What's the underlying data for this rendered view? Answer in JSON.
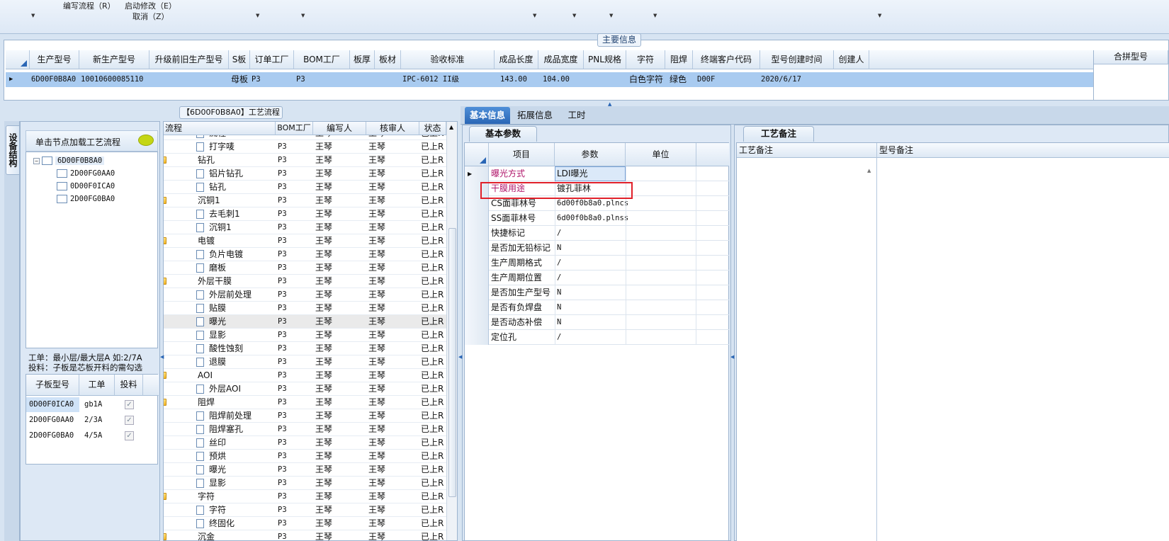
{
  "toolbar": {
    "edit_flow": "编写流程（R）",
    "start_modify": "启动修改（E）",
    "cancel": "取消（Z）"
  },
  "main_info": {
    "title": "主要信息"
  },
  "main_table": {
    "headers": [
      "生产型号",
      "新生产型号",
      "升级前旧生产型号",
      "S板",
      "订单工厂",
      "BOM工厂",
      "板厚",
      "板材",
      "验收标准",
      "成品长度",
      "成品宽度",
      "PNL规格",
      "字符",
      "阻焊",
      "终端客户代码",
      "型号创建时间",
      "创建人"
    ],
    "row": {
      "prod_model": "6D00F0B8A0",
      "new_model": "10010600085110",
      "s_board": "母板",
      "order_factory": "P3",
      "bom_factory": "P3",
      "standard": "IPC-6012 II级",
      "length": "143.00",
      "width": "104.00",
      "char": "白色字符",
      "mask": "绿色",
      "customer": "D00F",
      "created": "2020/6/17"
    },
    "combined_header": "合拼型号"
  },
  "left": {
    "vtab": "设备结构",
    "hint": "单击节点加载工艺流程",
    "tree": [
      "6D00F0B8A0",
      "2D00FG0AA0",
      "0D00F0ICA0",
      "2D00FG0BA0"
    ],
    "note1": "工单：最小层/最大层A 如:2/7A",
    "note2": "投料：子板是芯板开料的需勾选",
    "sub_headers": [
      "子板型号",
      "工单",
      "投料"
    ],
    "sub_rows": [
      [
        "0D00F0ICA0",
        "gb1A",
        "✓"
      ],
      [
        "2D00FG0AA0",
        "2/3A",
        "✓"
      ],
      [
        "2D00FG0BA0",
        "4/5A",
        "✓"
      ]
    ]
  },
  "flow": {
    "title": "【6D00F0B8A0】工艺流程",
    "headers": [
      "流程",
      "BOM工厂",
      "编写人",
      "核审人",
      "状态"
    ],
    "rows": [
      {
        "name": "流程",
        "level": 2,
        "bom": "P3",
        "writer": "王琴",
        "reviewer": "王琴",
        "status": "已上R"
      },
      {
        "name": "打字唛",
        "level": 2,
        "bom": "P3",
        "writer": "王琴",
        "reviewer": "王琴",
        "status": "已上R"
      },
      {
        "name": "钻孔",
        "level": 1,
        "bom": "P3",
        "writer": "王琴",
        "reviewer": "王琴",
        "status": "已上R"
      },
      {
        "name": "铝片钻孔",
        "level": 2,
        "bom": "P3",
        "writer": "王琴",
        "reviewer": "王琴",
        "status": "已上R"
      },
      {
        "name": "钻孔",
        "level": 2,
        "bom": "P3",
        "writer": "王琴",
        "reviewer": "王琴",
        "status": "已上R"
      },
      {
        "name": "沉铜1",
        "level": 1,
        "bom": "P3",
        "writer": "王琴",
        "reviewer": "王琴",
        "status": "已上R"
      },
      {
        "name": "去毛刺1",
        "level": 2,
        "bom": "P3",
        "writer": "王琴",
        "reviewer": "王琴",
        "status": "已上R"
      },
      {
        "name": "沉铜1",
        "level": 2,
        "bom": "P3",
        "writer": "王琴",
        "reviewer": "王琴",
        "status": "已上R"
      },
      {
        "name": "电镀",
        "level": 1,
        "bom": "P3",
        "writer": "王琴",
        "reviewer": "王琴",
        "status": "已上R"
      },
      {
        "name": "负片电镀",
        "level": 2,
        "bom": "P3",
        "writer": "王琴",
        "reviewer": "王琴",
        "status": "已上R"
      },
      {
        "name": "磨板",
        "level": 2,
        "bom": "P3",
        "writer": "王琴",
        "reviewer": "王琴",
        "status": "已上R"
      },
      {
        "name": "外层干膜",
        "level": 1,
        "bom": "P3",
        "writer": "王琴",
        "reviewer": "王琴",
        "status": "已上R"
      },
      {
        "name": "外层前处理",
        "level": 2,
        "bom": "P3",
        "writer": "王琴",
        "reviewer": "王琴",
        "status": "已上R"
      },
      {
        "name": "贴膜",
        "level": 2,
        "bom": "P3",
        "writer": "王琴",
        "reviewer": "王琴",
        "status": "已上R"
      },
      {
        "name": "曝光",
        "level": 2,
        "bom": "P3",
        "writer": "王琴",
        "reviewer": "王琴",
        "status": "已上R",
        "selected": true
      },
      {
        "name": "显影",
        "level": 2,
        "bom": "P3",
        "writer": "王琴",
        "reviewer": "王琴",
        "status": "已上R"
      },
      {
        "name": "酸性蚀刻",
        "level": 2,
        "bom": "P3",
        "writer": "王琴",
        "reviewer": "王琴",
        "status": "已上R"
      },
      {
        "name": "退膜",
        "level": 2,
        "bom": "P3",
        "writer": "王琴",
        "reviewer": "王琴",
        "status": "已上R"
      },
      {
        "name": "AOI",
        "level": 1,
        "bom": "P3",
        "writer": "王琴",
        "reviewer": "王琴",
        "status": "已上R"
      },
      {
        "name": "外层AOI",
        "level": 2,
        "bom": "P3",
        "writer": "王琴",
        "reviewer": "王琴",
        "status": "已上R"
      },
      {
        "name": "阻焊",
        "level": 1,
        "bom": "P3",
        "writer": "王琴",
        "reviewer": "王琴",
        "status": "已上R"
      },
      {
        "name": "阻焊前处理",
        "level": 2,
        "bom": "P3",
        "writer": "王琴",
        "reviewer": "王琴",
        "status": "已上R"
      },
      {
        "name": "阻焊塞孔",
        "level": 2,
        "bom": "P3",
        "writer": "王琴",
        "reviewer": "王琴",
        "status": "已上R"
      },
      {
        "name": "丝印",
        "level": 2,
        "bom": "P3",
        "writer": "王琴",
        "reviewer": "王琴",
        "status": "已上R"
      },
      {
        "name": "预烘",
        "level": 2,
        "bom": "P3",
        "writer": "王琴",
        "reviewer": "王琴",
        "status": "已上R"
      },
      {
        "name": "曝光",
        "level": 2,
        "bom": "P3",
        "writer": "王琴",
        "reviewer": "王琴",
        "status": "已上R"
      },
      {
        "name": "显影",
        "level": 2,
        "bom": "P3",
        "writer": "王琴",
        "reviewer": "王琴",
        "status": "已上R"
      },
      {
        "name": "字符",
        "level": 1,
        "bom": "P3",
        "writer": "王琴",
        "reviewer": "王琴",
        "status": "已上R"
      },
      {
        "name": "字符",
        "level": 2,
        "bom": "P3",
        "writer": "王琴",
        "reviewer": "王琴",
        "status": "已上R"
      },
      {
        "name": "终固化",
        "level": 2,
        "bom": "P3",
        "writer": "王琴",
        "reviewer": "王琴",
        "status": "已上R"
      },
      {
        "name": "沉金",
        "level": 1,
        "bom": "P3",
        "writer": "王琴",
        "reviewer": "王琴",
        "status": "已上R"
      }
    ]
  },
  "tabs": [
    "基本信息",
    "拓展信息",
    "工时"
  ],
  "params": {
    "subtab": "基本参数",
    "headers": [
      "项目",
      "参数",
      "单位"
    ],
    "rows": [
      {
        "item": "曝光方式",
        "value": "LDI曝光",
        "pink": true
      },
      {
        "item": "干膜用途",
        "value": "镀孔菲林",
        "pink": true,
        "highlight": true
      },
      {
        "item": "CS面菲林号",
        "value": "6d00f0b8a0.plncs"
      },
      {
        "item": "SS面菲林号",
        "value": "6d00f0b8a0.plnss"
      },
      {
        "item": "快捷标记",
        "value": "/"
      },
      {
        "item": "是否加无铅标记",
        "value": "N"
      },
      {
        "item": "生产周期格式",
        "value": "/"
      },
      {
        "item": "生产周期位置",
        "value": "/"
      },
      {
        "item": "是否加生产型号",
        "value": "N"
      },
      {
        "item": "是否有负焊盘",
        "value": "N"
      },
      {
        "item": "是否动态补偿",
        "value": "N"
      },
      {
        "item": "定位孔",
        "value": "/"
      }
    ]
  },
  "notes": {
    "tab": "工艺备注",
    "col1": "工艺备注",
    "col2": "型号备注"
  },
  "colors": {
    "accent": "#2a66b5",
    "row_select": "#a9cbf0",
    "pink": "#b0156a",
    "highlight_border": "#e0202a"
  }
}
